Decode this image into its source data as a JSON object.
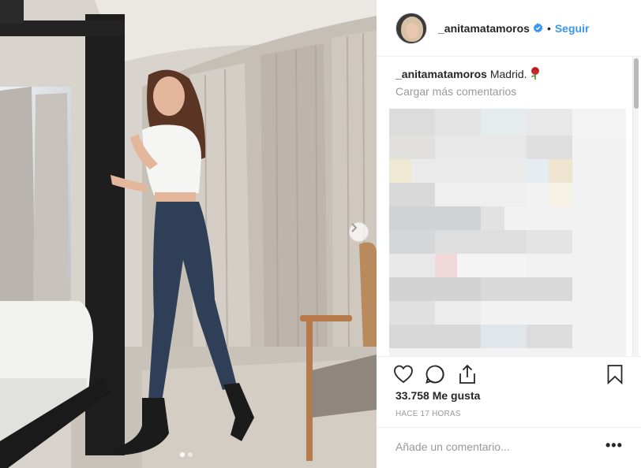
{
  "post": {
    "username": "_anitamatamoros",
    "separator": "•",
    "follow_label": "Seguir",
    "caption_text": "Madrid.",
    "load_more_label": "Cargar más comentarios",
    "likes": "33.758 Me gusta",
    "timestamp": "HACE 17 HORAS",
    "comment_placeholder": "Añade un comentario...",
    "more_label": "•••",
    "carousel": {
      "pages": 2,
      "current": 1
    }
  },
  "colors": {
    "accent": "#3897f0",
    "text": "#262626",
    "muted": "#999999",
    "border": "#efefef"
  },
  "icons": {
    "verified": "verified-badge-icon",
    "like": "heart-icon",
    "comment": "comment-bubble-icon",
    "share": "share-icon",
    "save": "bookmark-icon",
    "next": "chevron-right-icon",
    "caption_emoji": "rose-icon"
  }
}
